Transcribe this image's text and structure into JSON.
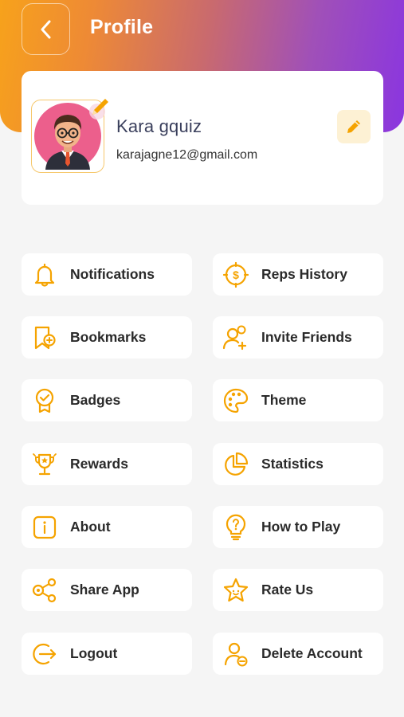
{
  "header": {
    "title": "Profile"
  },
  "profile": {
    "name": "Kara gquiz",
    "email": "karajagne12@gmail.com"
  },
  "colors": {
    "accent": "#f5a300",
    "gradient_start": "#f7a21b",
    "gradient_end": "#8a35e0"
  },
  "menu": {
    "left": [
      {
        "label": "Notifications",
        "icon": "bell-icon"
      },
      {
        "label": "Bookmarks",
        "icon": "bookmark-icon"
      },
      {
        "label": "Badges",
        "icon": "badge-icon"
      },
      {
        "label": "Rewards",
        "icon": "trophy-icon"
      },
      {
        "label": "About",
        "icon": "info-icon"
      },
      {
        "label": "Share App",
        "icon": "share-icon"
      },
      {
        "label": "Logout",
        "icon": "logout-icon"
      }
    ],
    "right": [
      {
        "label": "Reps History",
        "icon": "dollar-clock-icon"
      },
      {
        "label": "Invite Friends",
        "icon": "add-user-icon"
      },
      {
        "label": "Theme",
        "icon": "palette-icon"
      },
      {
        "label": "Statistics",
        "icon": "pie-chart-icon"
      },
      {
        "label": "How to Play",
        "icon": "lightbulb-question-icon"
      },
      {
        "label": "Rate Us",
        "icon": "star-icon"
      },
      {
        "label": "Delete Account",
        "icon": "remove-user-icon"
      }
    ]
  }
}
